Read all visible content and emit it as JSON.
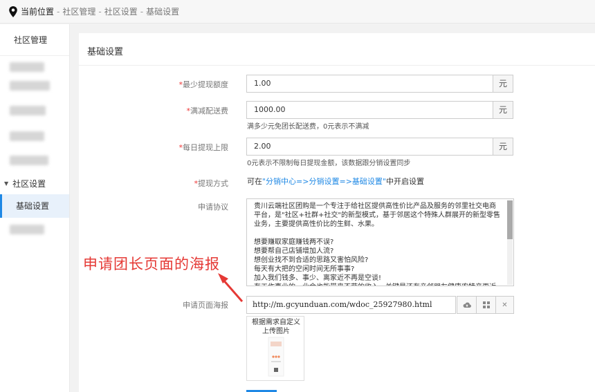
{
  "breadcrumb": {
    "label": "当前位置",
    "items": [
      "社区管理",
      "社区设置",
      "基础设置"
    ]
  },
  "sidebar": {
    "header": "社区管理",
    "section": "社区设置",
    "active_item": "基础设置"
  },
  "panel": {
    "title": "基础设置"
  },
  "form": {
    "min_withdraw": {
      "label": "最少提现额度",
      "value": "1.00",
      "unit": "元"
    },
    "free_shipping": {
      "label": "满减配送费",
      "value": "1000.00",
      "unit": "元",
      "help": "满多少元免团长配送费，0元表示不满减"
    },
    "daily_limit": {
      "label": "每日提现上限",
      "value": "2.00",
      "unit": "元",
      "help": "0元表示不限制每日提现金额，该数据跟分销设置同步"
    },
    "withdraw_method": {
      "label": "提现方式",
      "text_prefix": "可在",
      "link": "\"分销中心=>分销设置=>基础设置\"",
      "text_suffix": "中开启设置"
    },
    "agreement": {
      "label": "申请协议",
      "lines": [
        "贵川云端社区团购是一个专注于给社区提供高性价比产品及服务的邻里社交电商",
        "平台，是\"社区+社群+社交\"的新型模式，基于邻居这个特殊人群展开的新型零售",
        "业务，主要提供高性价比的生鲜、水果。",
        "",
        "想要赚取家庭赚钱两不误?",
        "想要帮自己店铺增加人流?",
        "想创业找不到合适的思路又害怕风险?",
        "每天有大把的空闲时间无所事事?",
        "加入我们钱多、事少、离家近不再是空谈!",
        "有工作事业的，业余也能带来不菲的收入，关键是还有亲邻朋友健康农特产更近"
      ]
    },
    "poster": {
      "label": "申请页面海报",
      "url": "http://m.gcyunduan.com/wdoc_25927980.html",
      "thumb_text": "根据需求自定义\n上传图片"
    }
  },
  "annotation": "申请团长页面的海报",
  "colors": {
    "accent": "#1e88e5",
    "required": "#ee3333",
    "annotation": "#e53935"
  }
}
